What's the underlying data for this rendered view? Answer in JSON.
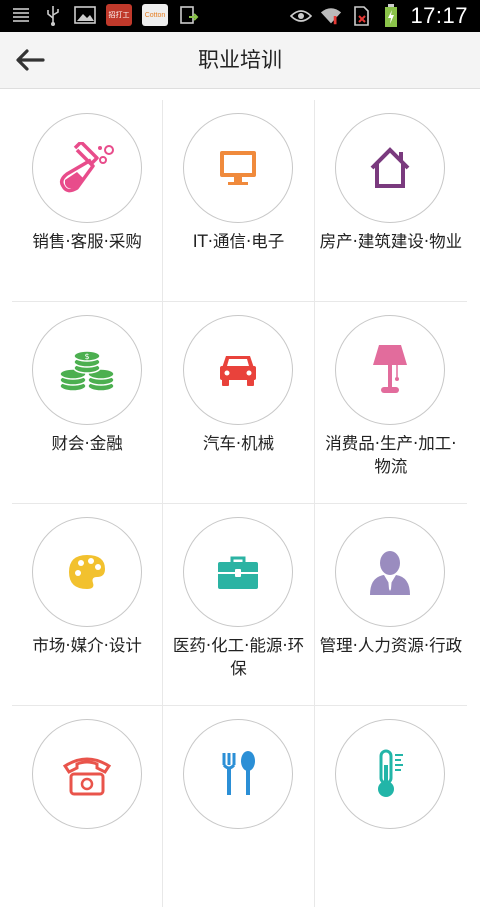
{
  "status_bar": {
    "time": "17:17",
    "app1_label": "招打工",
    "app2_label": "Cotton"
  },
  "header": {
    "title": "职业培训"
  },
  "categories": [
    {
      "label": "销售·客服·采购",
      "icon": "flask-icon",
      "color": "#e84c8b"
    },
    {
      "label": "IT·通信·电子",
      "icon": "monitor-icon",
      "color": "#f08a3c"
    },
    {
      "label": "房产·建筑建设·物业",
      "icon": "house-icon",
      "color": "#7a3a7e"
    },
    {
      "label": "财会·金融",
      "icon": "coins-icon",
      "color": "#4caf50"
    },
    {
      "label": "汽车·机械",
      "icon": "car-icon",
      "color": "#e9423b"
    },
    {
      "label": "消费品·生产·加工·物流",
      "icon": "lamp-icon",
      "color": "#e26c9c"
    },
    {
      "label": "市场·媒介·设计",
      "icon": "palette-icon",
      "color": "#f2c12e"
    },
    {
      "label": "医药·化工·能源·环保",
      "icon": "briefcase-icon",
      "color": "#2bb3a3"
    },
    {
      "label": "管理·人力资源·行政",
      "icon": "person-icon",
      "color": "#9a8cbf"
    },
    {
      "label": "",
      "icon": "telephone-icon",
      "color": "#e9544b"
    },
    {
      "label": "",
      "icon": "fork-spoon-icon",
      "color": "#2b8fd6"
    },
    {
      "label": "",
      "icon": "thermometer-icon",
      "color": "#22b5a8"
    }
  ]
}
